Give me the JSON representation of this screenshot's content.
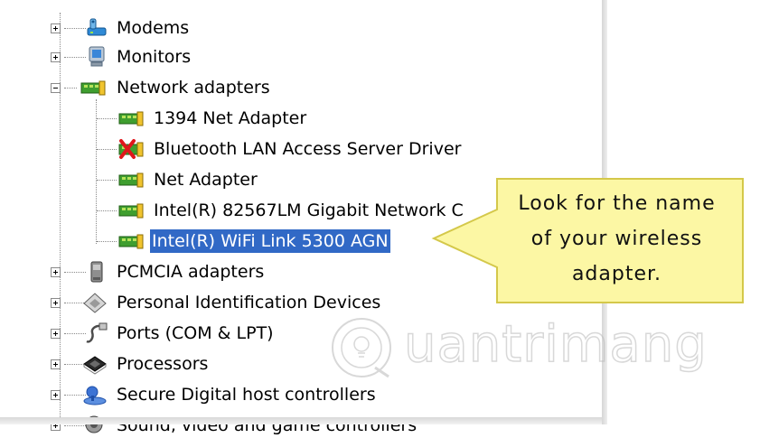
{
  "tree": {
    "items": [
      {
        "label": "Modems",
        "icon": "modem-icon",
        "expander": "plus"
      },
      {
        "label": "Monitors",
        "icon": "monitor-icon",
        "expander": "plus"
      },
      {
        "label": "Network adapters",
        "icon": "network-adapter-icon",
        "expander": "minus"
      },
      {
        "label": "1394 Net Adapter",
        "icon": "network-adapter-icon"
      },
      {
        "label": "Bluetooth LAN Access Server Driver",
        "icon": "disabled-network-adapter-icon"
      },
      {
        "label": "Net Adapter",
        "icon": "network-adapter-icon"
      },
      {
        "label": "Intel(R) 82567LM Gigabit Network C",
        "icon": "network-adapter-icon"
      },
      {
        "label": "Intel(R) WiFi Link 5300 AGN",
        "icon": "network-adapter-icon",
        "selected": true
      },
      {
        "label": "PCMCIA adapters",
        "icon": "pcmcia-icon",
        "expander": "plus"
      },
      {
        "label": "Personal Identification Devices",
        "icon": "identification-device-icon",
        "expander": "plus"
      },
      {
        "label": "Ports (COM & LPT)",
        "icon": "port-icon",
        "expander": "plus"
      },
      {
        "label": "Processors",
        "icon": "processor-icon",
        "expander": "plus"
      },
      {
        "label": "Secure Digital host controllers",
        "icon": "sd-controller-icon",
        "expander": "plus"
      },
      {
        "label": "Sound, video and game controllers",
        "icon": "sound-icon",
        "expander": "plus"
      }
    ]
  },
  "callout": {
    "line1": "Look for the name",
    "line2": "of your wireless",
    "line3": "adapter.",
    "fill": "#fcf7a4",
    "border": "#d4c84a"
  },
  "watermark": {
    "text": "uantrimang"
  },
  "colors": {
    "selection": "#3169c6"
  }
}
